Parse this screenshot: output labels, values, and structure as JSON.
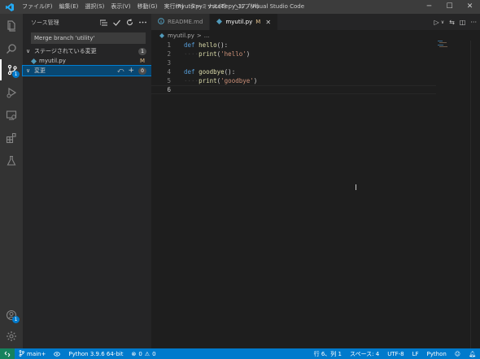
{
  "window": {
    "title": "myutil.py - vscodepy_17 - Visual Studio Code"
  },
  "menu": [
    "ファイル(F)",
    "編集(E)",
    "選択(S)",
    "表示(V)",
    "移動(G)",
    "実行(R)",
    "ターミナル(T)",
    "ヘルプ(H)"
  ],
  "activity": {
    "scm_badge": "1",
    "accounts_badge": "1"
  },
  "sidebar": {
    "title": "ソース管理",
    "commit_message": "Merge branch 'utility'",
    "staged": {
      "label": "ステージされている変更",
      "count": "1"
    },
    "staged_file": {
      "name": "myutil.py",
      "status": "M"
    },
    "changes": {
      "label": "変更",
      "count": "0"
    }
  },
  "tabs": [
    {
      "label": "README.md",
      "icon": "info-icon"
    },
    {
      "label": "myutil.py",
      "status": "M",
      "icon": "python-icon"
    }
  ],
  "breadcrumb": {
    "file": "myutil.py",
    "sep": ">",
    "rest": "..."
  },
  "code": [
    {
      "n": "1",
      "t": [
        [
          "kw",
          "def "
        ],
        [
          "fn",
          "hello"
        ],
        [
          "pn",
          "():"
        ]
      ]
    },
    {
      "n": "2",
      "t": [
        [
          "ind",
          "····"
        ],
        [
          "fn",
          "print"
        ],
        [
          "pn",
          "("
        ],
        [
          "str",
          "'hello'"
        ],
        [
          "pn",
          ")"
        ]
      ]
    },
    {
      "n": "3",
      "t": []
    },
    {
      "n": "4",
      "t": [
        [
          "kw",
          "def "
        ],
        [
          "fn",
          "goodbye"
        ],
        [
          "pn",
          "():"
        ]
      ]
    },
    {
      "n": "5",
      "t": [
        [
          "ind",
          "····"
        ],
        [
          "fn",
          "print"
        ],
        [
          "pn",
          "("
        ],
        [
          "str",
          "'goodbye'"
        ],
        [
          "pn",
          ")"
        ]
      ]
    },
    {
      "n": "6",
      "t": []
    }
  ],
  "status": {
    "branch": "main+",
    "python": "Python 3.9.6 64-bit",
    "errors": "0",
    "warnings": "0",
    "position": "行 6、列 1",
    "spaces": "スペース: 4",
    "encoding": "UTF-8",
    "eol": "LF",
    "language": "Python"
  },
  "colors": {
    "accent": "#007acc",
    "modified": "#e2c08d"
  }
}
